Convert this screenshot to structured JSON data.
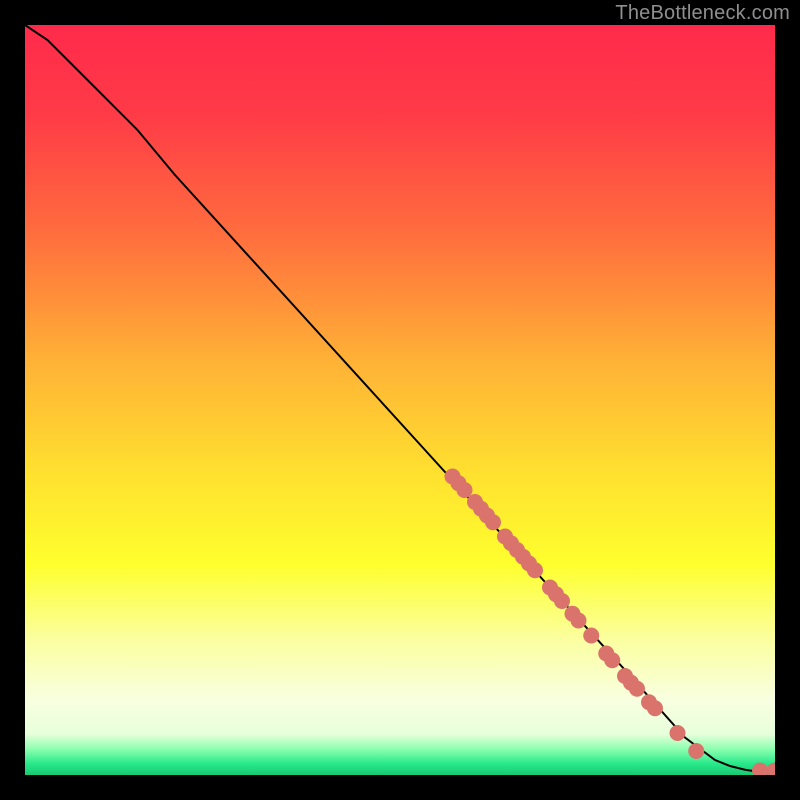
{
  "attribution": "TheBottleneck.com",
  "chart_data": {
    "type": "line",
    "title": "",
    "xlabel": "",
    "ylabel": "",
    "xlim": [
      0,
      100
    ],
    "ylim": [
      0,
      100
    ],
    "grid": false,
    "legend": false,
    "series": [
      {
        "name": "curve",
        "x": [
          0,
          3,
          6,
          10,
          15,
          20,
          30,
          40,
          50,
          60,
          70,
          80,
          88,
          92,
          94,
          96,
          97,
          98,
          99,
          100
        ],
        "y": [
          100,
          98,
          95,
          91,
          86,
          80,
          69,
          58,
          47,
          36,
          25,
          14,
          5,
          2,
          1.2,
          0.7,
          0.55,
          0.5,
          0.5,
          0.5
        ]
      }
    ],
    "highlight_points": {
      "name": "markers",
      "color": "#d9736c",
      "points_xy": [
        [
          57.0,
          39.8
        ],
        [
          57.8,
          38.9
        ],
        [
          58.6,
          38.0
        ],
        [
          60.0,
          36.4
        ],
        [
          60.8,
          35.5
        ],
        [
          61.6,
          34.6
        ],
        [
          62.4,
          33.7
        ],
        [
          64.0,
          31.8
        ],
        [
          64.8,
          30.9
        ],
        [
          65.6,
          30.0
        ],
        [
          66.4,
          29.1
        ],
        [
          67.2,
          28.2
        ],
        [
          68.0,
          27.3
        ],
        [
          70.0,
          25.0
        ],
        [
          70.8,
          24.1
        ],
        [
          71.6,
          23.2
        ],
        [
          73.0,
          21.5
        ],
        [
          73.8,
          20.6
        ],
        [
          75.5,
          18.6
        ],
        [
          77.5,
          16.2
        ],
        [
          78.3,
          15.3
        ],
        [
          80.0,
          13.2
        ],
        [
          80.8,
          12.3
        ],
        [
          81.6,
          11.5
        ],
        [
          83.2,
          9.7
        ],
        [
          84.0,
          8.9
        ],
        [
          87.0,
          5.6
        ],
        [
          89.5,
          3.2
        ],
        [
          98.0,
          0.6
        ],
        [
          100.0,
          0.6
        ]
      ]
    },
    "background_gradient": {
      "stops": [
        {
          "offset": 0.0,
          "color": "#ff2a4b"
        },
        {
          "offset": 0.12,
          "color": "#ff3b47"
        },
        {
          "offset": 0.28,
          "color": "#ff6e3e"
        },
        {
          "offset": 0.45,
          "color": "#ffb236"
        },
        {
          "offset": 0.6,
          "color": "#ffe12f"
        },
        {
          "offset": 0.72,
          "color": "#feff2e"
        },
        {
          "offset": 0.82,
          "color": "#fbffa0"
        },
        {
          "offset": 0.9,
          "color": "#f8ffe0"
        },
        {
          "offset": 0.945,
          "color": "#e8ffdc"
        },
        {
          "offset": 0.965,
          "color": "#8fffb0"
        },
        {
          "offset": 0.985,
          "color": "#27e98a"
        },
        {
          "offset": 1.0,
          "color": "#18c971"
        }
      ]
    }
  }
}
